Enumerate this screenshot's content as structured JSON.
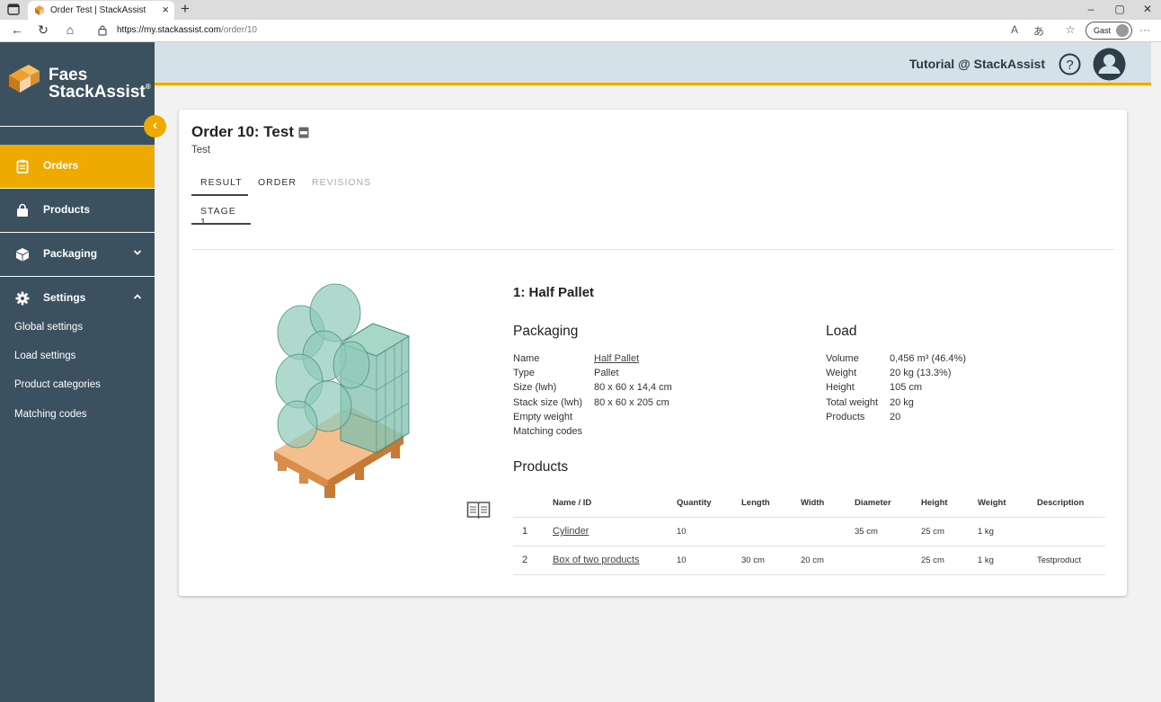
{
  "browser": {
    "tab_title": "Order Test | StackAssist",
    "url_host": "https://my.stackassist.com",
    "url_path": "/order/10",
    "guest_label": "Gast"
  },
  "logo": {
    "line1": "Faes",
    "line2": "StackAssist",
    "reg": "®"
  },
  "sidebar": {
    "items": [
      {
        "label": "Orders"
      },
      {
        "label": "Products"
      },
      {
        "label": "Packaging"
      },
      {
        "label": "Settings"
      }
    ],
    "settings_sub": [
      "Global settings",
      "Load settings",
      "Product categories",
      "Matching codes"
    ]
  },
  "header": {
    "title": "Tutorial @ StackAssist"
  },
  "order": {
    "title": "Order 10: Test",
    "subtitle": "Test",
    "tabs": [
      "RESULT",
      "ORDER",
      "REVISIONS"
    ],
    "subtabs": [
      "STAGE 1"
    ]
  },
  "result": {
    "title": "1: Half Pallet",
    "packaging": {
      "heading": "Packaging",
      "labels": [
        "Name",
        "Type",
        "Size (lwh)",
        "Stack size (lwh)",
        "Empty weight",
        "Matching codes"
      ],
      "values": [
        "Half Pallet",
        "Pallet",
        "80 x 60 x 14,4 cm",
        "80 x 60 x 205 cm",
        "",
        ""
      ]
    },
    "load": {
      "heading": "Load",
      "labels": [
        "Volume",
        "Weight",
        "Height",
        "Total weight",
        "Products"
      ],
      "values": [
        "0,456 m³ (46.4%)",
        "20 kg (13.3%)",
        "105 cm",
        "20 kg",
        "20"
      ]
    },
    "products": {
      "heading": "Products",
      "columns": [
        "",
        "Name / ID",
        "Quantity",
        "Length",
        "Width",
        "Diameter",
        "Height",
        "Weight",
        "Description"
      ],
      "rows": [
        {
          "num": "1",
          "name": "Cylinder",
          "quantity": "10",
          "length": "",
          "width": "",
          "diameter": "35 cm",
          "height": "25 cm",
          "weight": "1 kg",
          "description": ""
        },
        {
          "num": "2",
          "name": "Box of two products",
          "quantity": "10",
          "length": "30 cm",
          "width": "20 cm",
          "diameter": "",
          "height": "25 cm",
          "weight": "1 kg",
          "description": "Testproduct"
        }
      ]
    }
  },
  "colors": {
    "accent": "#efaa00",
    "sidebar": "#3c5160",
    "header": "#d5e1e9"
  }
}
